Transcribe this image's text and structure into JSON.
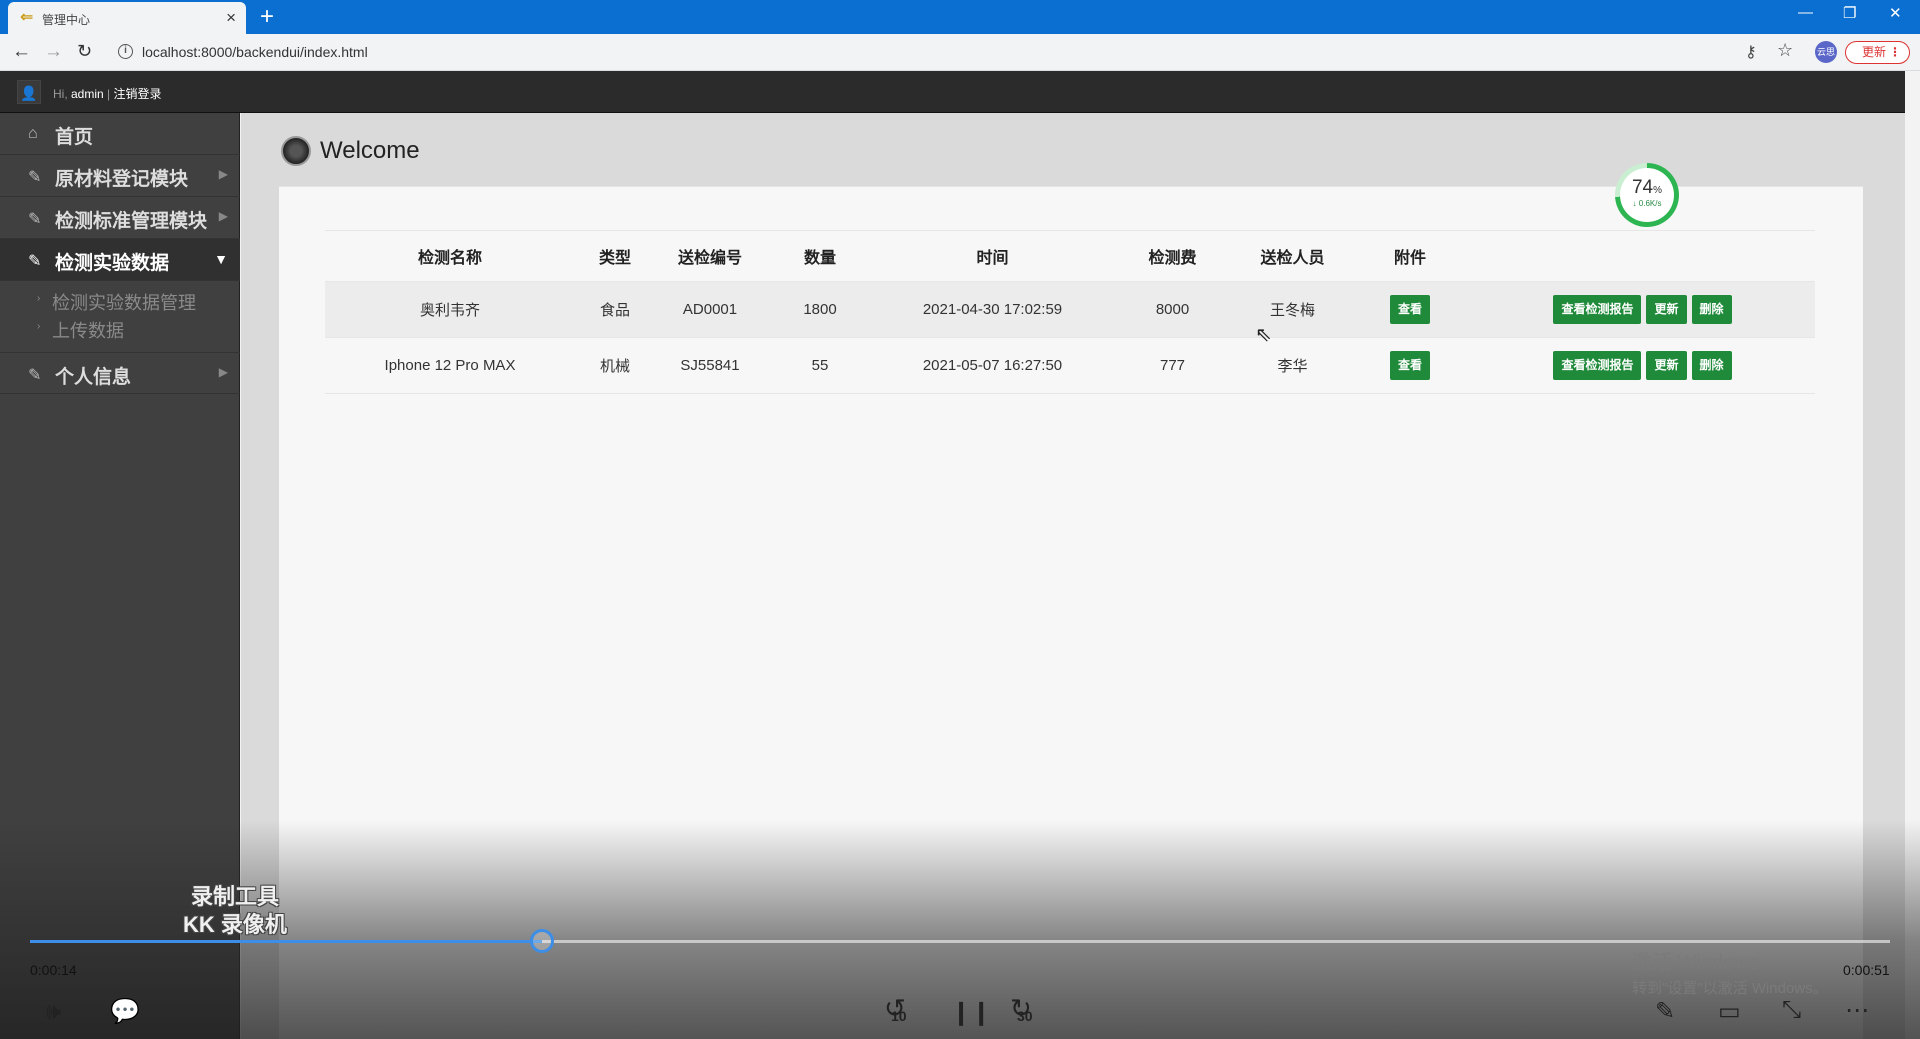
{
  "browser": {
    "tab_title": "管理中心",
    "tab_close": "×",
    "new_tab": "+",
    "minimize": "—",
    "restore": "❐",
    "close": "✕",
    "url": "localhost:8000/backendui/index.html",
    "profile": "云思",
    "update_label": "更新",
    "update_menu": "⋮"
  },
  "header": {
    "greeting_prefix": "Hi, ",
    "username": "admin",
    "separator": " | ",
    "logout": "注销登录"
  },
  "sidebar": {
    "items": [
      {
        "label": "首页",
        "icon": "home-icon"
      },
      {
        "label": "原材料登记模块",
        "icon": "edit-icon"
      },
      {
        "label": "检测标准管理模块",
        "icon": "edit-icon"
      },
      {
        "label": "检测实验数据",
        "icon": "edit-icon",
        "active": true
      },
      {
        "label": "个人信息",
        "icon": "edit-icon"
      }
    ],
    "subitems": [
      "检测实验数据管理",
      "上传数据"
    ]
  },
  "main": {
    "title": "Welcome"
  },
  "speed": {
    "percent": "74",
    "unit": "%",
    "rate": "↓ 0.6K/s",
    "fill_fraction": 0.74
  },
  "table": {
    "columns": [
      "检测名称",
      "类型",
      "送检编号",
      "数量",
      "时间",
      "检测费",
      "送检人员",
      "附件"
    ],
    "rows": [
      {
        "name": "奥利韦齐",
        "type": "食品",
        "code": "AD0001",
        "qty": "1800",
        "time": "2021-04-30 17:02:59",
        "fee": "8000",
        "person": "王冬梅",
        "attach": "查看"
      },
      {
        "name": "Iphone 12 Pro MAX",
        "type": "机械",
        "code": "SJ55841",
        "qty": "55",
        "time": "2021-05-07 16:27:50",
        "fee": "777",
        "person": "李华",
        "attach": "查看"
      }
    ],
    "actions": {
      "report": "查看检测报告",
      "update": "更新",
      "delete": "删除"
    }
  },
  "player": {
    "watermark_line1": "录制工具",
    "watermark_line2": "KK 录像机",
    "current_time": "0:00:14",
    "total_time": "0:00:51",
    "progress_fraction": 0.275,
    "skip_back": "10",
    "skip_forward": "30"
  },
  "watermark_os": {
    "line1": "激活 Windows",
    "line2": "转到\"设置\"以激活 Windows。"
  },
  "colors": {
    "accent_green": "#1f8a3a",
    "browser_blue": "#0a6fd0",
    "sidebar_bg": "#404040",
    "progress_blue": "#3d8ee6"
  }
}
